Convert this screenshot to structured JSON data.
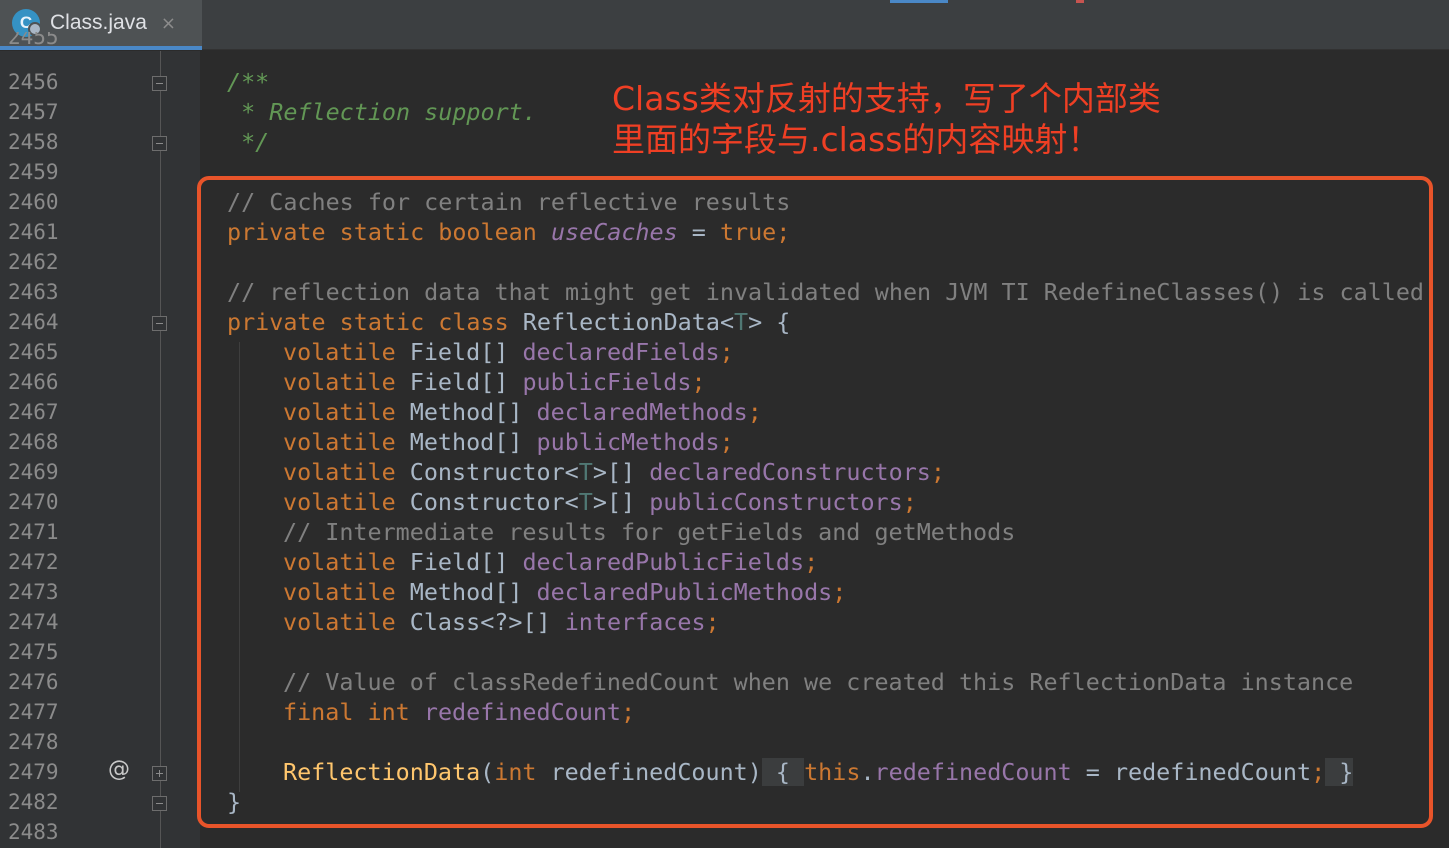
{
  "tab": {
    "label": "Class.java",
    "icon": "C",
    "close": "×"
  },
  "gutter": {
    "partial_line": "2455",
    "line_numbers": [
      "2456",
      "2457",
      "2458",
      "2459",
      "2460",
      "2461",
      "2462",
      "2463",
      "2464",
      "2465",
      "2466",
      "2467",
      "2468",
      "2469",
      "2470",
      "2471",
      "2472",
      "2473",
      "2474",
      "2475",
      "2476",
      "2477",
      "2478",
      "2479",
      "2482",
      "2483"
    ],
    "override_marker": "@"
  },
  "code": {
    "doc_open": "/**",
    "doc_body": " * Reflection support.",
    "doc_close": " */",
    "comment_caches": "// Caches for certain reflective results",
    "kw_private": "private",
    "kw_static": "static",
    "kw_boolean": "boolean",
    "kw_class": "class",
    "kw_volatile": "volatile",
    "kw_final": "final",
    "kw_int": "int",
    "kw_true": "true",
    "kw_this": "this",
    "use_caches": "useCaches",
    "comment_reflection_data": "// reflection data that might get invalidated when JVM TI RedefineClasses() is called",
    "class_name": "ReflectionData",
    "type_param": "T",
    "type_Field": "Field",
    "type_Method": "Method",
    "type_Constructor": "Constructor",
    "type_Class": "Class",
    "wildcard": "<?>",
    "arr": "[]",
    "f_declaredFields": "declaredFields",
    "f_publicFields": "publicFields",
    "f_declaredMethods": "declaredMethods",
    "f_publicMethods": "publicMethods",
    "f_declaredConstructors": "declaredConstructors",
    "f_publicConstructors": "publicConstructors",
    "comment_intermediate": "// Intermediate results for getFields and getMethods",
    "f_declaredPublicFields": "declaredPublicFields",
    "f_declaredPublicMethods": "declaredPublicMethods",
    "f_interfaces": "interfaces",
    "comment_value_of": "// Value of classRedefinedCount when we created this ReflectionData instance",
    "f_redefinedCount": "redefinedCount",
    "param_redefinedCount": "redefinedCount"
  },
  "annotation": {
    "line1": "Class类对反射的支持，写了个内部类",
    "line2": "里面的字段与.class的内容映射！"
  },
  "colors": {
    "background": "#2b2b2b",
    "keyword": "#cc7832",
    "comment": "#808080",
    "doc_comment": "#629755",
    "field": "#9876aa",
    "method": "#ffc66d",
    "annotation_red": "#ef3f24",
    "highlight_border": "#e8542a"
  }
}
